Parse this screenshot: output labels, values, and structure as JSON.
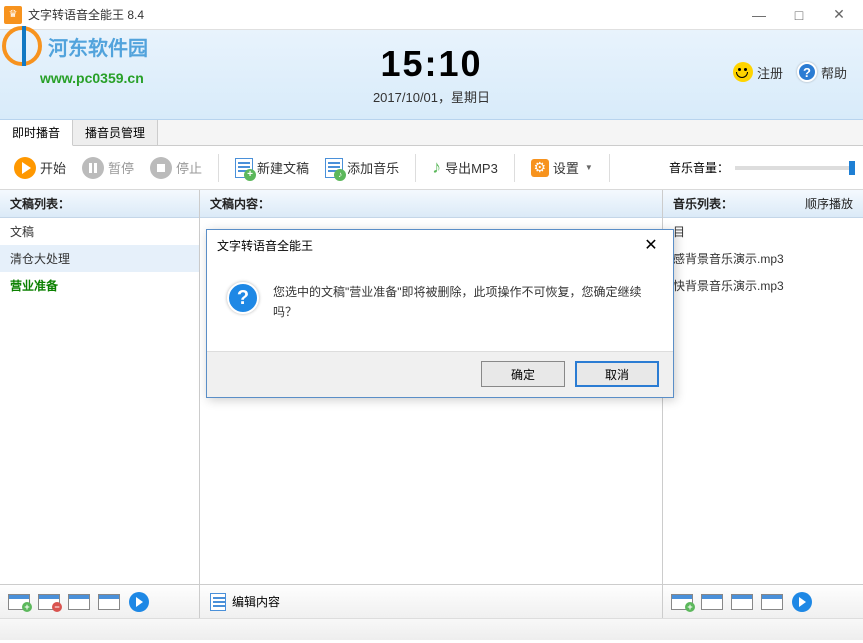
{
  "window": {
    "title": "文字转语音全能王 8.4",
    "minimize": "—",
    "maximize": "□",
    "close": "✕"
  },
  "watermark": {
    "text": "河东软件园",
    "url": "www.pc0359.cn"
  },
  "clock": {
    "time": "15:10",
    "date": "2017/10/01，星期日"
  },
  "header": {
    "register": "注册",
    "help": "帮助"
  },
  "tabs": [
    {
      "label": "即时播音",
      "active": true
    },
    {
      "label": "播音员管理",
      "active": false
    }
  ],
  "toolbar": {
    "start": "开始",
    "pause": "暂停",
    "stop": "停止",
    "new_doc": "新建文稿",
    "add_music": "添加音乐",
    "export_mp3": "导出MP3",
    "settings": "设置",
    "volume_label": "音乐音量："
  },
  "columns": {
    "left_header": "文稿列表：",
    "mid_header": "文稿内容：",
    "right_header": "音乐列表：",
    "right_mode": "顺序播放"
  },
  "docs": [
    {
      "name": "文稿"
    },
    {
      "name": "清仓大处理"
    },
    {
      "name": "营业准备",
      "highlight": true
    }
  ],
  "playlist": {
    "header": "目",
    "items": [
      "感背景音乐演示.mp3",
      "快背景音乐演示.mp3"
    ]
  },
  "bottom": {
    "edit_content": "编辑内容"
  },
  "modal": {
    "title": "文字转语音全能王",
    "message": "您选中的文稿\"营业准备\"即将被删除，此项操作不可恢复，您确定继续吗？",
    "ok": "确定",
    "cancel": "取消"
  }
}
